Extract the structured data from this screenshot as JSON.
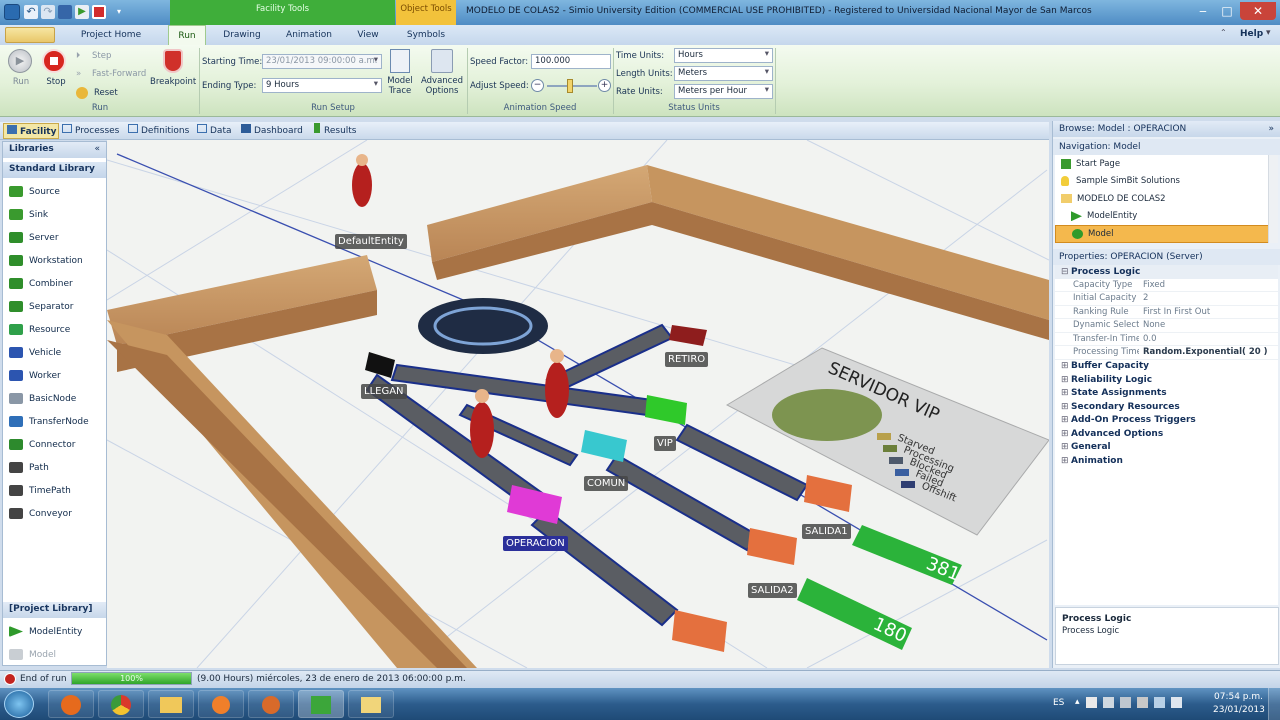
{
  "window": {
    "title": "MODELO DE COLAS2 - Simio University Edition (COMMERCIAL USE PROHIBITED) - Registered to Universidad Nacional Mayor de San Marcos",
    "context_facility_tools": "Facility Tools",
    "context_object_tools": "Object Tools"
  },
  "tabs": [
    "Project Home",
    "Run",
    "Drawing",
    "Animation",
    "View",
    "Symbols"
  ],
  "help_label": "Help",
  "ribbon": {
    "run_label": "Run",
    "stop_label": "Stop",
    "step_label": "Step",
    "fast_forward_label": "Fast-Forward",
    "reset_label": "Reset",
    "breakpoint_label": "Breakpoint",
    "group_run": "Run",
    "starting_time_label": "Starting Time:",
    "starting_time_value": "23/01/2013 09:00:00 a.m.",
    "ending_type_label": "Ending Type:",
    "ending_type_value": "9 Hours",
    "model_trace_label": "Model Trace",
    "advanced_options_label": "Advanced Options",
    "group_run_setup": "Run Setup",
    "speed_factor_label": "Speed Factor:",
    "speed_factor_value": "100.000",
    "adjust_speed_label": "Adjust Speed:",
    "group_animation_speed": "Animation Speed",
    "time_units_label": "Time Units:",
    "time_units_value": "Hours",
    "length_units_label": "Length Units:",
    "length_units_value": "Meters",
    "rate_units_label": "Rate Units:",
    "rate_units_value": "Meters per Hour",
    "group_status_units": "Status Units"
  },
  "subtabs": [
    "Facility",
    "Processes",
    "Definitions",
    "Data",
    "Dashboard",
    "Results"
  ],
  "libraries": {
    "header": "Libraries",
    "standard_header": "Standard Library",
    "standard_items": [
      {
        "label": "Source",
        "color": "#3a9a2e"
      },
      {
        "label": "Sink",
        "color": "#3a9a2e"
      },
      {
        "label": "Server",
        "color": "#2f8e2b"
      },
      {
        "label": "Workstation",
        "color": "#2f8e2b"
      },
      {
        "label": "Combiner",
        "color": "#2f8e2b"
      },
      {
        "label": "Separator",
        "color": "#2f8e2b"
      },
      {
        "label": "Resource",
        "color": "#2fa04a"
      },
      {
        "label": "Vehicle",
        "color": "#2c55b0"
      },
      {
        "label": "Worker",
        "color": "#2c55b0"
      },
      {
        "label": "BasicNode",
        "color": "#8a97a6"
      },
      {
        "label": "TransferNode",
        "color": "#2f6fb8"
      },
      {
        "label": "Connector",
        "color": "#2d8a2d"
      },
      {
        "label": "Path",
        "color": "#444444"
      },
      {
        "label": "TimePath",
        "color": "#444444"
      },
      {
        "label": "Conveyor",
        "color": "#444444"
      }
    ],
    "project_header": "[Project Library]",
    "project_items": [
      "ModelEntity",
      "Model"
    ]
  },
  "facility_labels": {
    "default_entity": "DefaultEntity",
    "llegan": "LLEGAN",
    "retiro": "RETIRO",
    "vip": "VIP",
    "comun": "COMUN",
    "operacion": "OPERACION",
    "salida1": "SALIDA1",
    "salida2": "SALIDA2",
    "counter_1": "381",
    "counter_2": "180",
    "servidor_vip": "SERVIDOR VIP",
    "legend": [
      "Starved",
      "Processing",
      "Blocked",
      "Failed",
      "Offshift"
    ]
  },
  "navigation": {
    "browse_header": "Browse: Model : OPERACION",
    "nav_header": "Navigation: Model",
    "items": [
      "Start Page",
      "Sample SimBit Solutions",
      "MODELO DE COLAS2",
      "ModelEntity",
      "Model"
    ]
  },
  "properties": {
    "header": "Properties: OPERACION (Server)",
    "process_logic": "Process Logic",
    "rows": [
      {
        "key": "Capacity Type",
        "value": "Fixed"
      },
      {
        "key": "Initial Capacity",
        "value": "2"
      },
      {
        "key": "Ranking Rule",
        "value": "First In First Out"
      },
      {
        "key": "Dynamic Selectio...",
        "value": "None"
      },
      {
        "key": "Transfer-In Time",
        "value": "0.0"
      },
      {
        "key": "Processing Time",
        "value": "Random.Exponential( 20 )"
      }
    ],
    "categories": [
      "Buffer Capacity",
      "Reliability Logic",
      "State Assignments",
      "Secondary Resources",
      "Add-On Process Triggers",
      "Advanced Options",
      "General",
      "Animation"
    ],
    "description_title": "Process Logic",
    "description_text": "Process Logic"
  },
  "status": {
    "end_of_run": "End of run",
    "progress_text": "100%",
    "progress": 1.0,
    "time_text": "(9.00 Hours) miércoles, 23 de enero de 2013 06:00:00 p.m."
  },
  "taskbar": {
    "lang": "ES",
    "time": "07:54 p.m.",
    "date": "23/01/2013"
  }
}
